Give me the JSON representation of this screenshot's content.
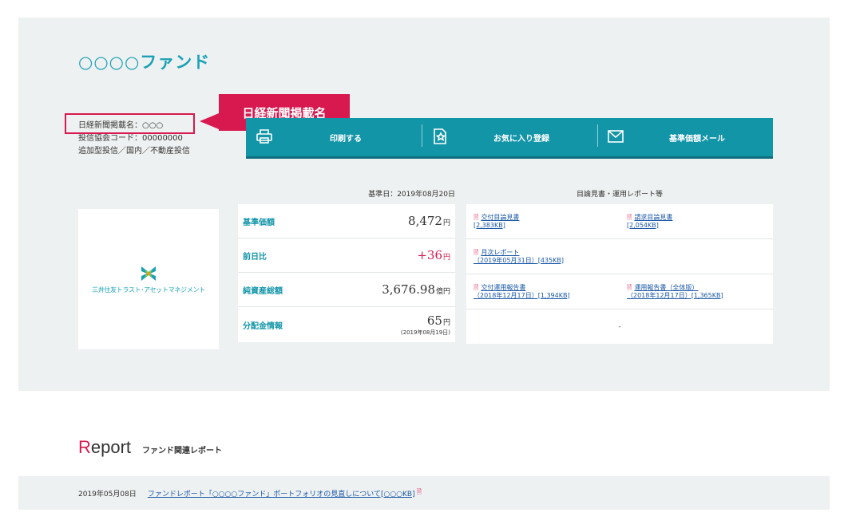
{
  "fund": {
    "title": "○○○○ファンド",
    "nikkei_name": "日経新聞掲載名：○○○",
    "association_code": "投信協会コード：00000000",
    "category": "追加型投信／国内／不動産投信"
  },
  "callout": {
    "label": "日経新聞掲載名"
  },
  "toolbar": {
    "print": "印刷する",
    "favorite": "お気に入り登録",
    "mail": "基準価額メール"
  },
  "logo": {
    "text": "三井住友トラスト･アセットマネジメント"
  },
  "prices": {
    "base_date": "基準日：2019年08月20日",
    "rows": [
      {
        "label": "基準価額",
        "value": "8,472",
        "unit": "円"
      },
      {
        "label": "前日比",
        "value": "+36",
        "unit": "円"
      },
      {
        "label": "純資産総額",
        "value": "3,676.98",
        "unit": "億円"
      },
      {
        "label": "分配金情報",
        "value": "65",
        "unit": "円",
        "sub": "(2019年08月19日)"
      }
    ]
  },
  "documents": {
    "header": "目論見書・運用レポート等",
    "items": [
      {
        "title": "交付目論見書",
        "size": "[2,383KB]"
      },
      {
        "title": "請求目論見書",
        "size": "[2,054KB]"
      },
      {
        "title": "月次レポート",
        "size": "（2019年05月31日）[435KB]"
      },
      {
        "title": "交付運用報告書",
        "size": "（2018年12月17日）[1,394KB]"
      },
      {
        "title": "運用報告書（全体版）",
        "size": "（2018年12月17日）[1,365KB]"
      }
    ],
    "empty": "-"
  },
  "report": {
    "title_first": "R",
    "title_rest": "eport",
    "subtitle": "ファンド関連レポート",
    "date": "2019年05月08日",
    "link": "ファンドレポート「○○○○ファンド」ポートフォリオの見直しについて[○○○KB]"
  },
  "colors": {
    "accent": "#1395a8",
    "title": "#1ba1b5",
    "highlight": "#d7194f",
    "link": "#1a58a8",
    "panel": "#eef1f1"
  }
}
